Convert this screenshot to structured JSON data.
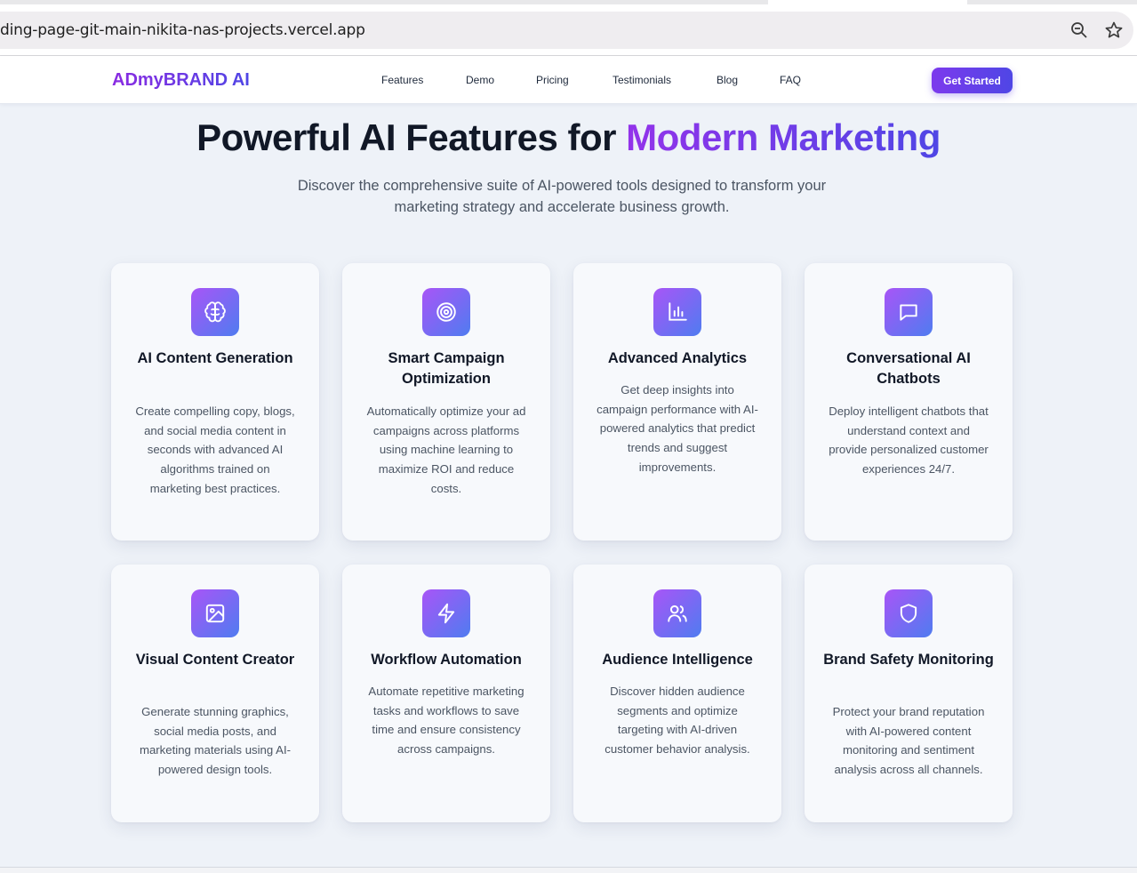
{
  "browser": {
    "url": "ding-page-git-main-nikita-nas-projects.vercel.app",
    "icons": [
      "zoom-icon",
      "star-icon"
    ]
  },
  "nav": {
    "logo": "ADmyBRAND AI",
    "links": [
      "Features",
      "Demo",
      "Pricing",
      "Testimonials",
      "Blog",
      "FAQ"
    ],
    "cta": "Get Started"
  },
  "hero": {
    "title_plain": "Powerful AI Features for ",
    "title_highlight": "Modern Marketing",
    "subtitle": "Discover the comprehensive suite of AI-powered tools designed to transform your marketing strategy and accelerate business growth."
  },
  "colors": {
    "accent_start": "#a855f7",
    "accent_end": "#4f46e5",
    "page_bg": "#eef2f8"
  },
  "features": [
    {
      "icon": "brain-icon",
      "title": "AI Content Generation",
      "description": "Create compelling copy, blogs, and social media content in seconds with advanced AI algorithms trained on marketing best practices."
    },
    {
      "icon": "target-icon",
      "title": "Smart Campaign Optimization",
      "description": "Automatically optimize your ad campaigns across platforms using machine learning to maximize ROI and reduce costs."
    },
    {
      "icon": "bar-chart-icon",
      "title": "Advanced Analytics",
      "description": "Get deep insights into campaign performance with AI-powered analytics that predict trends and suggest improvements."
    },
    {
      "icon": "chat-bubble-icon",
      "title": "Conversational AI Chatbots",
      "description": "Deploy intelligent chatbots that understand context and provide personalized customer experiences 24/7."
    },
    {
      "icon": "image-icon",
      "title": "Visual Content Creator",
      "description": "Generate stunning graphics, social media posts, and marketing materials using AI-powered design tools."
    },
    {
      "icon": "lightning-icon",
      "title": "Workflow Automation",
      "description": "Automate repetitive marketing tasks and workflows to save time and ensure consistency across campaigns."
    },
    {
      "icon": "users-icon",
      "title": "Audience Intelligence",
      "description": "Discover hidden audience segments and optimize targeting with AI-driven customer behavior analysis."
    },
    {
      "icon": "shield-icon",
      "title": "Brand Safety Monitoring",
      "description": "Protect your brand reputation with AI-powered content monitoring and sentiment analysis across all channels."
    }
  ]
}
